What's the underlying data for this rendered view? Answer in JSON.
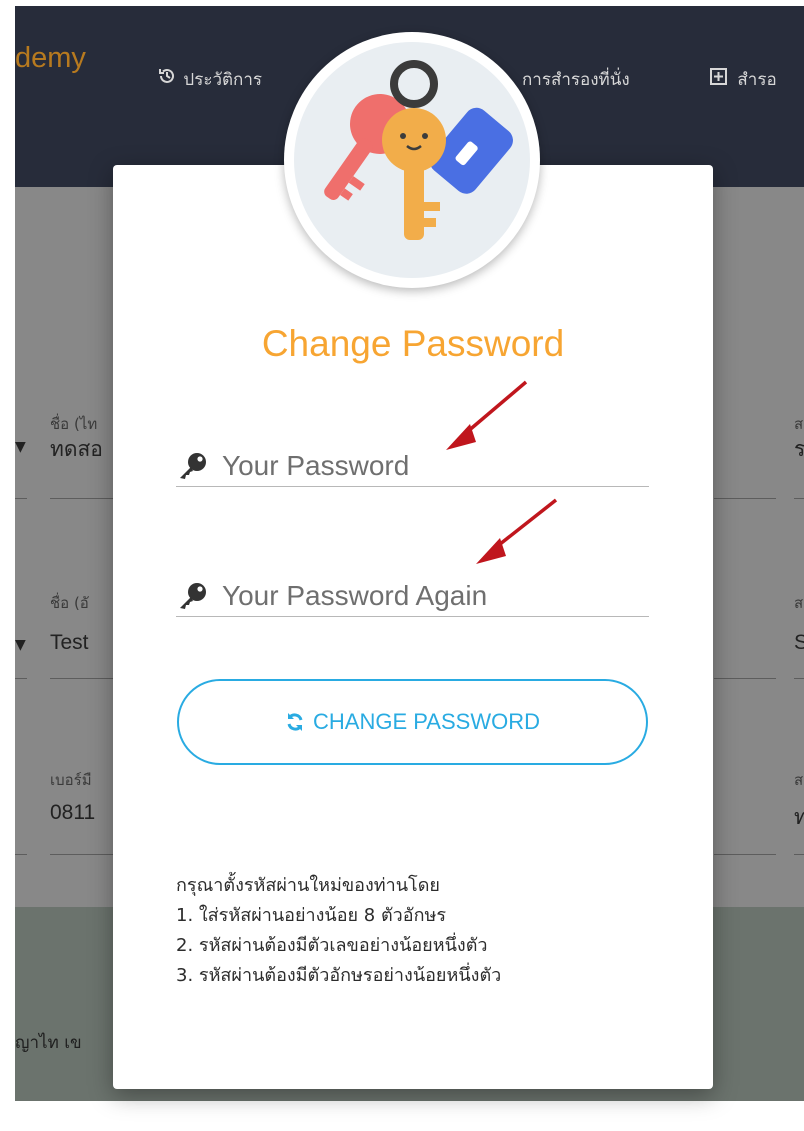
{
  "background": {
    "brand": "demy",
    "nav": [
      {
        "icon": "history-icon",
        "label": "ประวัติการ"
      },
      {
        "label": "การสำรองที่นั่ง"
      },
      {
        "icon": "plus-square-icon",
        "label": "สำรอ"
      }
    ],
    "form": {
      "name_th_label": "ชื่อ (ไท",
      "name_th_value": "ทดสอ",
      "name_en_label": "ชื่อ (อั",
      "name_en_value": "Test",
      "phone_label": "เบอร์มื",
      "phone_value": "0811",
      "right_label_1": "ส",
      "right_value_1": "ร",
      "right_label_2": "ส",
      "right_value_2": "S",
      "right_label_3": "ส",
      "right_value_3": "ท"
    },
    "footer_text": "ญาไท เข"
  },
  "modal": {
    "illustration": "keys-icon",
    "title": "Change Password",
    "password_placeholder": "Your Password",
    "password_again_placeholder": "Your Password Again",
    "button_label": "CHANGE PASSWORD",
    "button_icon": "refresh-icon",
    "rules_intro": "กรุณาตั้งรหัสผ่านใหม่ของท่านโดย",
    "rules": [
      "1. ใส่รหัสผ่านอย่างน้อย 8 ตัวอักษร",
      "2. รหัสผ่านต้องมีตัวเลขอย่างน้อยหนึ่งตัว",
      "3. รหัสผ่านต้องมีตัวอักษรอย่างน้อยหนึ่งตัว"
    ]
  },
  "colors": {
    "accent_orange": "#f7a532",
    "accent_blue": "#29abe2",
    "annotation_arrow": "#c0161d"
  }
}
